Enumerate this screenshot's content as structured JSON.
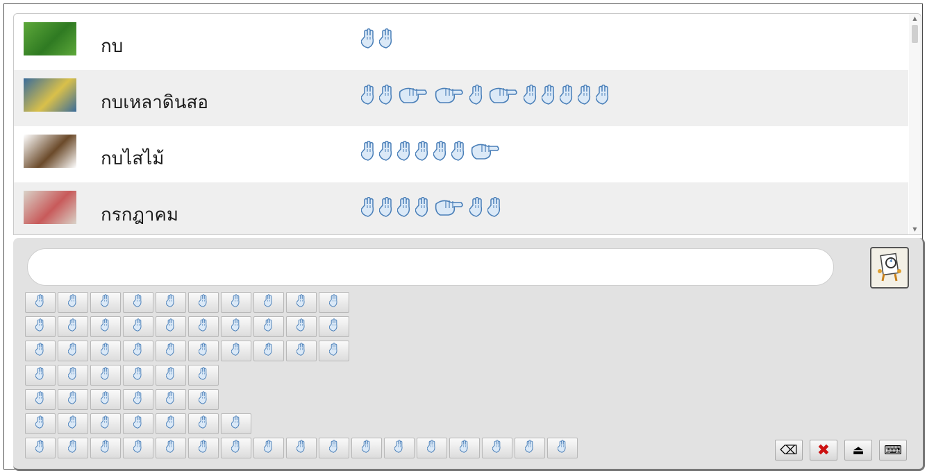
{
  "entries": [
    {
      "word": "กบ",
      "thumb_colors": [
        "#5da83a",
        "#2f7a22"
      ],
      "signs": [
        "hand",
        "hand"
      ]
    },
    {
      "word": "กบเหลาดินสอ",
      "thumb_colors": [
        "#3a6c9a",
        "#d9c04a"
      ],
      "signs": [
        "hand",
        "hand",
        "wide",
        "wide",
        "hand",
        "wide",
        "hand",
        "hand",
        "hand",
        "hand",
        "hand"
      ]
    },
    {
      "word": "กบไสไม้",
      "thumb_colors": [
        "#ffffff",
        "#6b4a2a"
      ],
      "signs": [
        "hand",
        "hand",
        "hand",
        "hand",
        "hand",
        "hand",
        "wide"
      ]
    },
    {
      "word": "กรกฎาคม",
      "thumb_colors": [
        "#d9d2c8",
        "#c85a5a"
      ],
      "signs": [
        "hand",
        "hand",
        "hand",
        "hand",
        "wide",
        "hand",
        "hand"
      ]
    }
  ],
  "search": {
    "value": "",
    "placeholder": ""
  },
  "search_button": {
    "icon": "fingerspell-search-icon"
  },
  "keyboard": {
    "rows": [
      10,
      10,
      10,
      6,
      6,
      7,
      17
    ],
    "key_icon": "handshape-icon"
  },
  "controls": [
    {
      "name": "backspace-button",
      "icon": "backspace-icon",
      "glyph": "⌫"
    },
    {
      "name": "clear-button",
      "icon": "close-icon",
      "glyph": "✖"
    },
    {
      "name": "eject-button",
      "icon": "eject-icon",
      "glyph": "⏏"
    },
    {
      "name": "keyboard-button",
      "icon": "keyboard-icon",
      "glyph": "⌨"
    }
  ],
  "colors": {
    "panel": "#e2e2e2",
    "hand_stroke": "#4a7fb8",
    "hand_fill": "#dbe9f7",
    "alt_row": "#efefef"
  }
}
